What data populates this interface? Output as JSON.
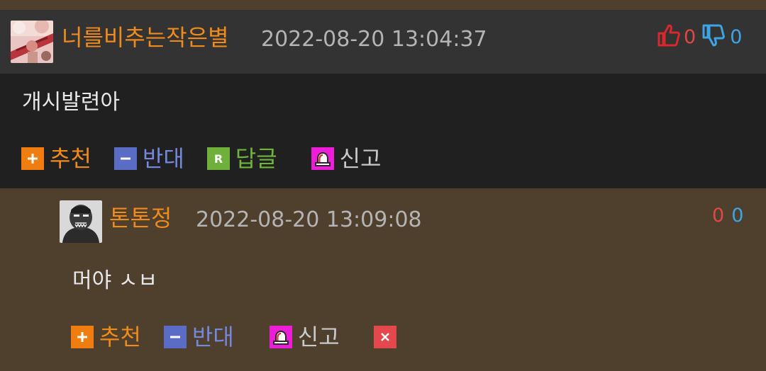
{
  "comment": {
    "author": "너를비추는작은별",
    "timestamp": "2022-08-20 13:04:37",
    "votes": {
      "up": "0",
      "down": "0"
    },
    "body": "개시발련아",
    "actions": {
      "recommend": "추천",
      "oppose": "반대",
      "reply": "답글",
      "report": "신고"
    }
  },
  "reply": {
    "author": "톤톤정",
    "timestamp": "2022-08-20 13:09:08",
    "votes": {
      "up": "0",
      "down": "0"
    },
    "body": "머야 ㅅㅂ",
    "actions": {
      "recommend": "추천",
      "oppose": "반대",
      "report": "신고"
    }
  },
  "icons": {
    "plus": "plus-icon",
    "minus": "minus-icon",
    "reply": "reply-r-icon",
    "report": "alarm-siren-icon",
    "delete": "close-icon",
    "thumb_up": "thumbs-up-icon",
    "thumb_down": "thumbs-down-icon"
  },
  "colors": {
    "author": "#ef8a1c",
    "up": "#e04848",
    "down": "#3da4e6",
    "recommend": "#ef7d10",
    "oppose": "#5a6cc6",
    "reply": "#6fb03a",
    "report": "#ee1ed8",
    "delete": "#e4484c"
  }
}
